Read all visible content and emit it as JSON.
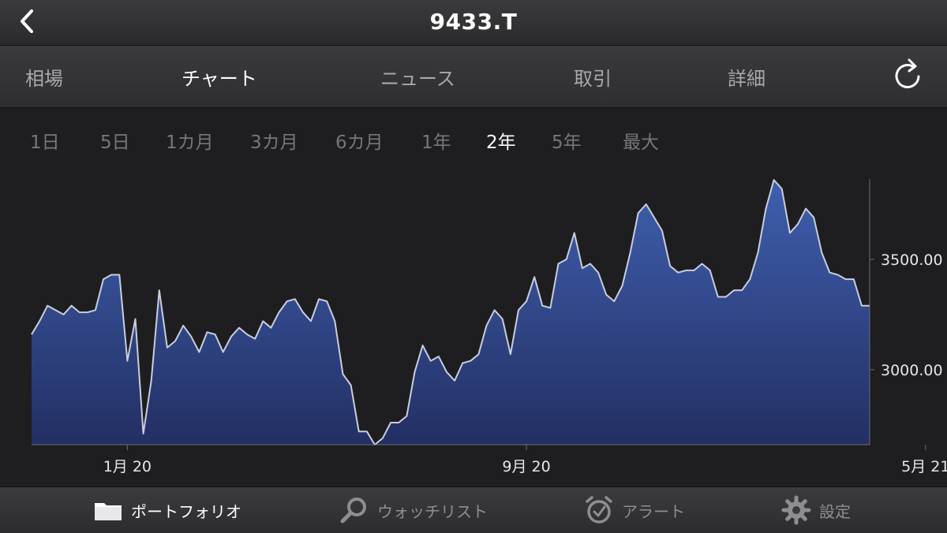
{
  "header": {
    "title": "9433.T",
    "back_icon": "chevron-left-icon"
  },
  "tabs": [
    {
      "label": "相場",
      "active": false
    },
    {
      "label": "チャート",
      "active": true
    },
    {
      "label": "ニュース",
      "active": false
    },
    {
      "label": "取引",
      "active": false
    },
    {
      "label": "詳細",
      "active": false
    }
  ],
  "refresh_icon": "refresh-icon",
  "ranges": [
    {
      "label": "1日",
      "active": false
    },
    {
      "label": "5日",
      "active": false
    },
    {
      "label": "1カ月",
      "active": false
    },
    {
      "label": "3カ月",
      "active": false
    },
    {
      "label": "6カ月",
      "active": false
    },
    {
      "label": "1年",
      "active": false
    },
    {
      "label": "2年",
      "active": true
    },
    {
      "label": "5年",
      "active": false
    },
    {
      "label": "最大",
      "active": false
    }
  ],
  "colors": {
    "fill_top": "#3f5fae",
    "fill_bottom": "#232f63",
    "line": "#c9cedc",
    "axis": "#6e6e72",
    "label": "#e6e6e8"
  },
  "chart_data": {
    "type": "area",
    "y_ticks": [
      {
        "value": 3000,
        "label": "3000.00"
      },
      {
        "value": 3500,
        "label": "3500.00"
      }
    ],
    "x_ticks": [
      {
        "index": 12,
        "label": "1月 20"
      },
      {
        "index": 62,
        "label": "9月 20"
      },
      {
        "index": 112,
        "label": "5月 21"
      }
    ],
    "ylim": [
      2660,
      3900
    ],
    "values": [
      3160,
      3220,
      3290,
      3270,
      3250,
      3290,
      3260,
      3260,
      3270,
      3410,
      3430,
      3430,
      3040,
      3230,
      2710,
      2950,
      3360,
      3100,
      3130,
      3200,
      3150,
      3080,
      3170,
      3160,
      3080,
      3150,
      3190,
      3160,
      3140,
      3220,
      3190,
      3260,
      3310,
      3320,
      3260,
      3220,
      3320,
      3310,
      3220,
      2980,
      2930,
      2720,
      2720,
      2660,
      2690,
      2760,
      2760,
      2790,
      2990,
      3110,
      3040,
      3060,
      2990,
      2950,
      3030,
      3040,
      3070,
      3200,
      3270,
      3230,
      3070,
      3270,
      3310,
      3420,
      3290,
      3280,
      3480,
      3500,
      3620,
      3460,
      3480,
      3440,
      3340,
      3310,
      3380,
      3530,
      3710,
      3750,
      3690,
      3630,
      3470,
      3440,
      3450,
      3450,
      3480,
      3450,
      3330,
      3330,
      3360,
      3360,
      3410,
      3530,
      3730,
      3860,
      3820,
      3620,
      3660,
      3730,
      3690,
      3530,
      3440,
      3430,
      3410,
      3410,
      3290,
      3290
    ]
  },
  "bottom_nav": [
    {
      "label": "ポートフォリオ",
      "icon": "folder-icon",
      "active": true
    },
    {
      "label": "ウォッチリスト",
      "icon": "magnifier-icon",
      "active": false
    },
    {
      "label": "アラート",
      "icon": "alarm-clock-icon",
      "active": false
    },
    {
      "label": "設定",
      "icon": "gear-icon",
      "active": false
    }
  ]
}
